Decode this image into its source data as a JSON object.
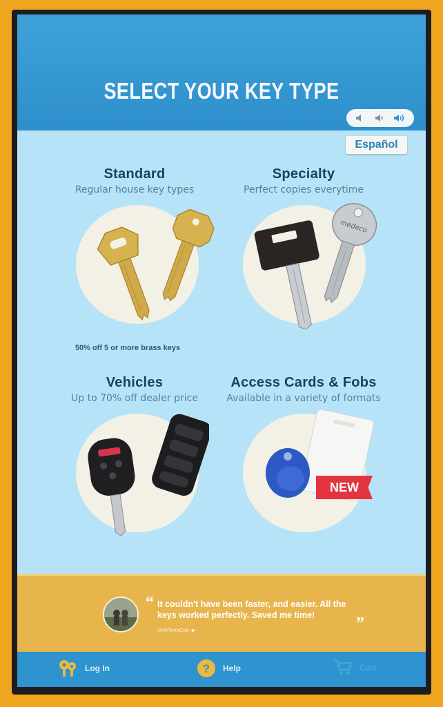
{
  "header": {
    "title": "SELECT YOUR KEY TYPE",
    "volume_levels": [
      "mute-icon",
      "volume-low-icon",
      "volume-high-icon"
    ],
    "selected_volume": "volume-high-icon",
    "language_button": "Español"
  },
  "categories": [
    {
      "title": "Standard",
      "subtitle": "Regular house key types",
      "promo": "50% off 5 or more brass keys",
      "icon": "brass-house-keys-icon"
    },
    {
      "title": "Specialty",
      "subtitle": "Perfect copies everytime",
      "icon": "specialty-keys-icon",
      "key_brand": "medeco"
    },
    {
      "title": "Vehicles",
      "subtitle": "Up to 70% off dealer price",
      "icon": "car-keys-icon"
    },
    {
      "title": "Access Cards & Fobs",
      "subtitle": "Available in a variety of formats",
      "icon": "access-card-fob-icon",
      "badge": "NEW"
    }
  ],
  "testimonial": {
    "quote": "It couldn't have been faster, and easier. All the keys worked perfectly. Saved me time!",
    "handle": "@MrTonoCott"
  },
  "footer": {
    "login": "Log In",
    "help": "Help",
    "cart": "Cart"
  },
  "colors": {
    "header_blue": "#2e8fcc",
    "background_light_blue": "#b6e3f7",
    "title_navy": "#1e3d5f",
    "testimonial_gold": "#e8b54c",
    "badge_red": "#e23540",
    "kiosk_frame_orange": "#f0a51e"
  }
}
